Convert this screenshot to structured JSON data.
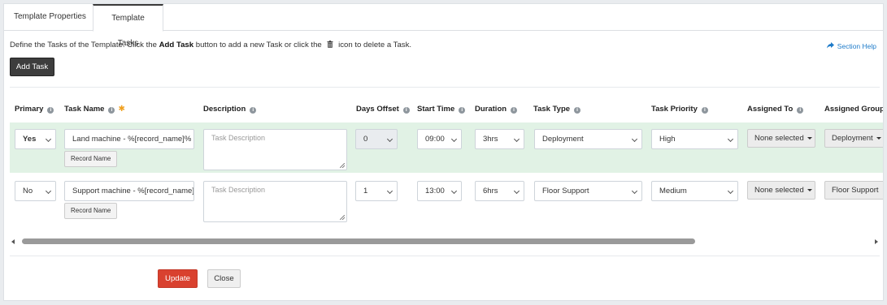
{
  "tabs": [
    {
      "label": "Template Properties"
    },
    {
      "label": "Template Tasks"
    }
  ],
  "intro": {
    "part1": "Define the Tasks of the Template. Click the ",
    "bold": "Add Task",
    "part2": " button to add a new Task or click the ",
    "part3": " icon to delete a Task."
  },
  "section_help": "Section Help",
  "add_task_label": "Add Task",
  "columns": {
    "primary": "Primary",
    "task_name": "Task Name",
    "description": "Description",
    "days_offset": "Days Offset",
    "start_time": "Start Time",
    "duration": "Duration",
    "task_type": "Task Type",
    "task_priority": "Task Priority",
    "assigned_to": "Assigned To",
    "assigned_group": "Assigned Group"
  },
  "rows": [
    {
      "primary": "Yes",
      "task_name": "Land machine - %[record_name]%",
      "record_name_chip": "Record Name",
      "description_placeholder": "Task Description",
      "days_offset": "0",
      "start_time": "09:00",
      "duration": "3hrs",
      "task_type": "Deployment",
      "task_priority": "High",
      "assigned_to": "None selected",
      "assigned_group": "Deployment"
    },
    {
      "primary": "No",
      "task_name": "Support machine - %[record_name]%",
      "record_name_chip": "Record Name",
      "description_placeholder": "Task Description",
      "days_offset": "1",
      "start_time": "13:00",
      "duration": "6hrs",
      "task_type": "Floor Support",
      "task_priority": "Medium",
      "assigned_to": "None selected",
      "assigned_group": "Floor Support"
    }
  ],
  "buttons": {
    "update": "Update",
    "close": "Close"
  },
  "colors": {
    "primary_row_bg": "#e1f2e5",
    "update_button": "#d9412f",
    "add_task_button": "#3d3d3d",
    "link": "#1e7bc9"
  }
}
